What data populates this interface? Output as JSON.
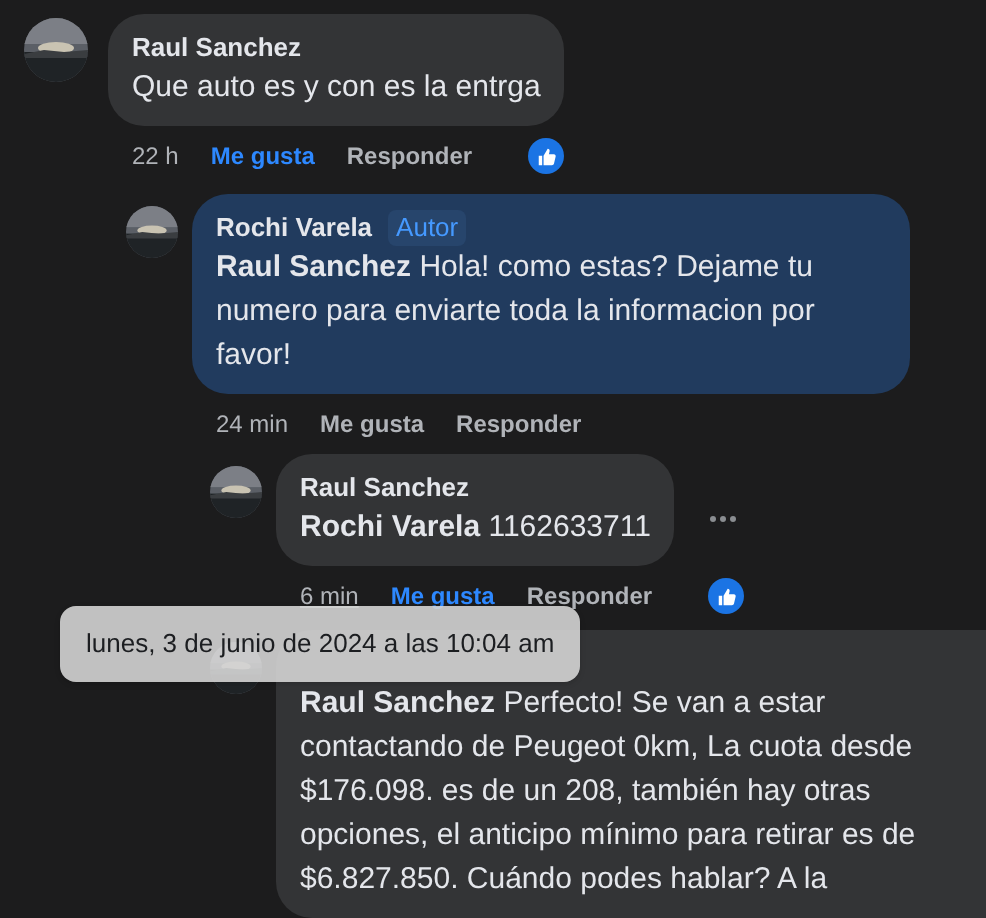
{
  "comments": [
    {
      "author": "Raul Sanchez",
      "highlighted": false,
      "text": "Que auto es y con es la entrga",
      "time": "22 h",
      "time_hovered": false,
      "like_label": "Me gusta",
      "liked": true,
      "reply_label": "Responder",
      "has_reactions": true,
      "show_more": false,
      "children": [
        {
          "author": "Rochi Varela",
          "badge": "Autor",
          "highlighted": true,
          "text": "**Raul Sanchez** Hola! como estas? Dejame tu numero para enviarte toda la informacion por favor!",
          "time": "24 min",
          "time_hovered": false,
          "like_label": "Me gusta",
          "liked": false,
          "reply_label": "Responder",
          "has_reactions": false,
          "show_more": false,
          "children": [
            {
              "author": "Raul Sanchez",
              "highlighted": false,
              "text": "**Rochi Varela** 1162633711",
              "time": "6 min",
              "time_hovered": true,
              "like_label": "Me gusta",
              "liked": true,
              "reply_label": "Responder",
              "has_reactions": true,
              "show_more": true
            },
            {
              "highlighted": false,
              "text": "**Raul Sanchez** Perfecto! Se van a estar contactando de Peugeot 0km, La cuota desde $176.098. es de un 208, también hay otras opciones, el anticipo mínimo para retirar es de $6.827.850. Cuándo podes hablar? A la"
            }
          ]
        }
      ]
    }
  ],
  "tooltip": {
    "text": "lunes, 3 de junio de 2024 a las 10:04 am"
  }
}
